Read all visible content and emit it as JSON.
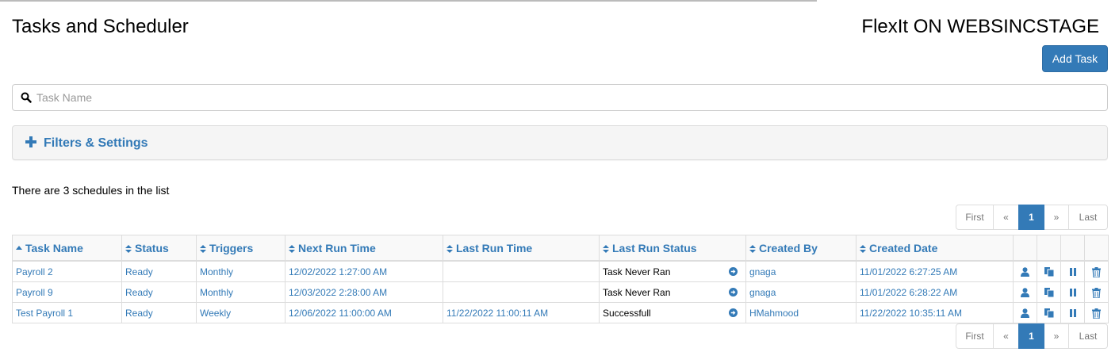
{
  "header": {
    "title": "Tasks and Scheduler",
    "environment": "FlexIt ON WEBSINCSTAGE",
    "add_task_label": "Add Task"
  },
  "search": {
    "placeholder": "Task Name",
    "value": ""
  },
  "filters": {
    "label": "Filters & Settings"
  },
  "summary": "There are 3 schedules in the list",
  "pagination": {
    "first": "First",
    "prev": "«",
    "current": "1",
    "next": "»",
    "last": "Last"
  },
  "table": {
    "headers": {
      "task_name": "Task Name",
      "status": "Status",
      "triggers": "Triggers",
      "next_run_time": "Next Run Time",
      "last_run_time": "Last Run Time",
      "last_run_status": "Last Run Status",
      "created_by": "Created By",
      "created_date": "Created Date"
    },
    "rows": [
      {
        "task_name": "Payroll 2",
        "status": "Ready",
        "triggers": "Monthly",
        "next_run_time": "12/02/2022 1:27:00 AM",
        "last_run_time": "",
        "last_run_status": "Task Never Ran",
        "created_by": "gnaga",
        "created_date": "11/01/2022 6:27:25 AM"
      },
      {
        "task_name": "Payroll 9",
        "status": "Ready",
        "triggers": "Monthly",
        "next_run_time": "12/03/2022 2:28:00 AM",
        "last_run_time": "",
        "last_run_status": "Task Never Ran",
        "created_by": "gnaga",
        "created_date": "11/01/2022 6:28:22 AM"
      },
      {
        "task_name": "Test Payroll 1",
        "status": "Ready",
        "triggers": "Weekly",
        "next_run_time": "12/06/2022 11:00:00 AM",
        "last_run_time": "11/22/2022 11:00:11 AM",
        "last_run_status": "Successfull",
        "created_by": "HMahmood",
        "created_date": "11/22/2022 10:35:11 AM"
      }
    ]
  },
  "icons": {
    "search": "search-icon",
    "filters": "plus-icon",
    "status_detail": "arrow-circle-right-icon",
    "actions": [
      "user-icon",
      "copy-icon",
      "pause-icon",
      "trash-icon"
    ]
  },
  "colors": {
    "primary": "#337ab7",
    "border": "#dddddd",
    "panel": "#f5f5f5"
  }
}
